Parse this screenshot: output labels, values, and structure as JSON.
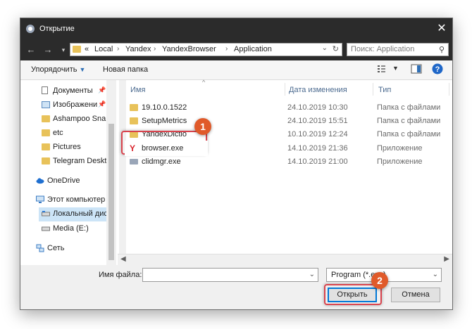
{
  "window": {
    "title": "Открытие"
  },
  "address": {
    "segments": [
      "«",
      "Local",
      "Yandex",
      "YandexBrowser",
      "Application"
    ]
  },
  "search": {
    "placeholder": "Поиск: Application"
  },
  "toolbar": {
    "organize_label": "Упорядочить",
    "new_folder_label": "Новая папка"
  },
  "sidebar": {
    "items": [
      {
        "label": "Документы",
        "pinned": true
      },
      {
        "label": "Изображени",
        "pinned": true
      },
      {
        "label": "Ashampoo Snap"
      },
      {
        "label": "etc"
      },
      {
        "label": "Pictures"
      },
      {
        "label": "Telegram Deskto"
      },
      {
        "label": "OneDrive"
      },
      {
        "label": "Этот компьютер"
      },
      {
        "label": "Локальный дис",
        "selected": true
      },
      {
        "label": "Media (E:)"
      },
      {
        "label": "Сеть"
      }
    ]
  },
  "columns": {
    "name": "Имя",
    "date": "Дата изменения",
    "type": "Тип"
  },
  "files": [
    {
      "name": "19.10.0.1522",
      "date": "24.10.2019 10:30",
      "type": "Папка с файлами",
      "kind": "folder"
    },
    {
      "name": "SetupMetrics",
      "date": "24.10.2019 15:51",
      "type": "Папка с файлами",
      "kind": "folder"
    },
    {
      "name": "YandexDictio",
      "date": "10.10.2019 12:24",
      "type": "Папка с файлами",
      "kind": "folder"
    },
    {
      "name": "browser.exe",
      "date": "14.10.2019 21:36",
      "type": "Приложение",
      "kind": "yandex"
    },
    {
      "name": "clidmgr.exe",
      "date": "14.10.2019 21:00",
      "type": "Приложение",
      "kind": "exe"
    }
  ],
  "bottom": {
    "filename_label": "Имя файла:",
    "filename_value": "",
    "filter_value": "Program (*.exe)",
    "open_label": "Открыть",
    "cancel_label": "Отмена"
  },
  "annotations": {
    "step1": "1",
    "step2": "2"
  },
  "colors": {
    "titlebar": "#2b2b2b",
    "highlight": "#d9434d",
    "badge": "#e05a2a",
    "accent": "#0078d7"
  }
}
